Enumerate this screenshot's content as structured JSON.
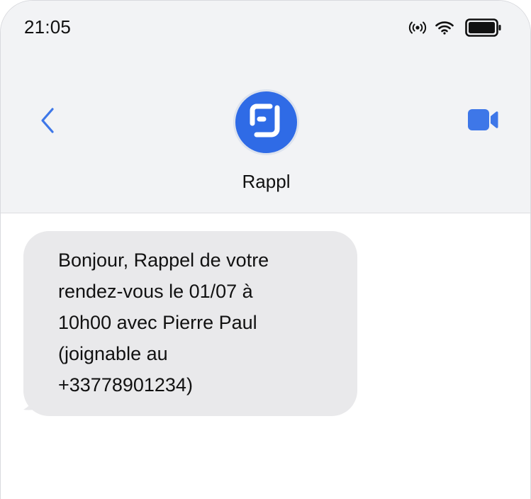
{
  "status_bar": {
    "time": "21:05",
    "icons": [
      "signal-icon",
      "wifi-icon",
      "battery-icon"
    ]
  },
  "header": {
    "back_icon": "chevron-left-icon",
    "video_icon": "video-camera-icon",
    "contact_name": "Rappl",
    "avatar_icon": "rappl-logo"
  },
  "colors": {
    "accent": "#2f6be6",
    "header_bg": "#f2f3f5",
    "bubble_bg": "#e9e9eb"
  },
  "messages": [
    {
      "direction": "incoming",
      "text": "Bonjour, Rappel de votre\nrendez-vous le 01/07 à\n10h00 avec Pierre Paul\n(joignable au\n+33778901234)"
    }
  ]
}
